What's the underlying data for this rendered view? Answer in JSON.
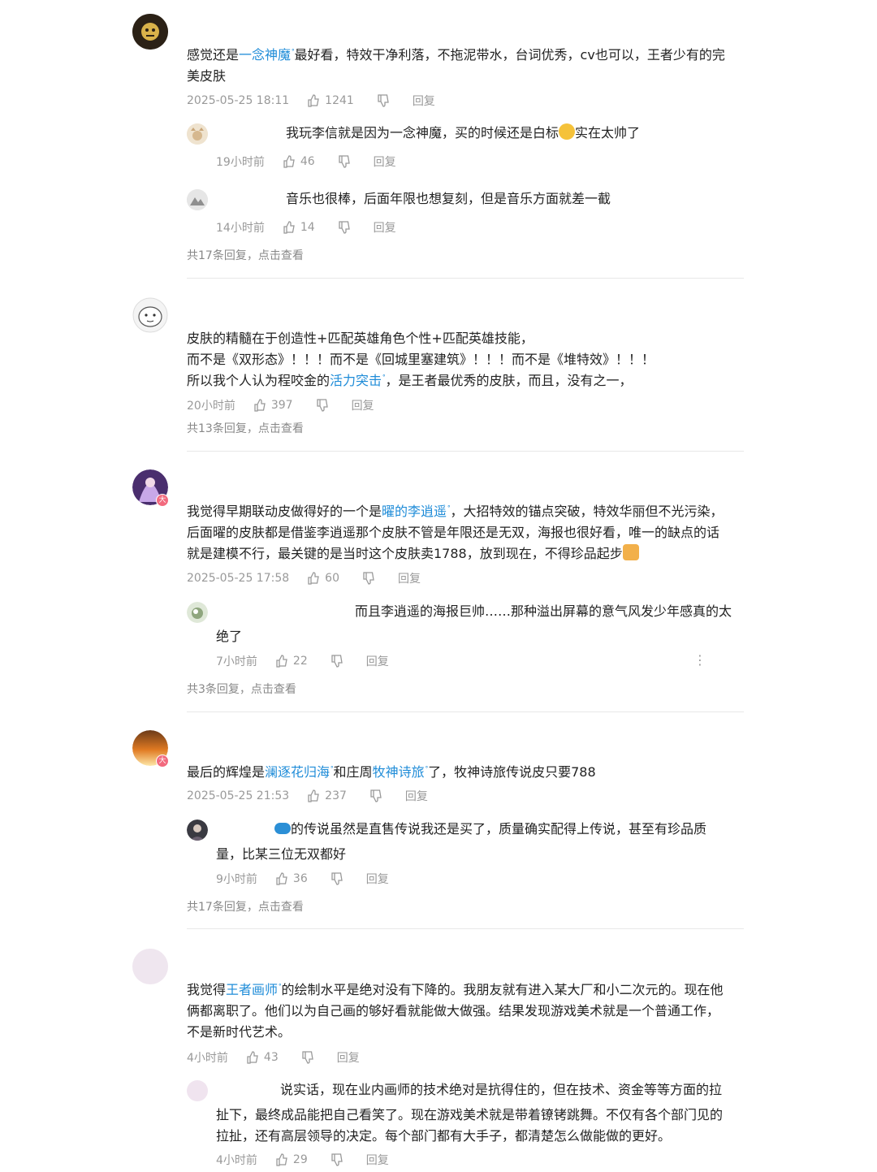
{
  "comments": [
    {
      "parts": [
        "感觉还是",
        "一念神魔",
        "最好看，特效干净利落，不拖泥带水，台词优秀，cv也可以，王者少有的完",
        "美皮肤"
      ],
      "time": "2025-05-25 18:11",
      "likes": "1241",
      "reply_label": "回复",
      "replies": [
        {
          "text_a": "我玩李信就是因为一念神魔，买的时候还是白标",
          "text_b": "实在太帅了",
          "time": "19小时前",
          "likes": "46",
          "reply_label": "回复"
        },
        {
          "text": "音乐也很棒，后面年限也想复刻，但是音乐方面就差一截",
          "time": "14小时前",
          "likes": "14",
          "reply_label": "回复"
        }
      ],
      "more": "共17条回复，点击查看"
    },
    {
      "line1": "皮肤的精髓在于创造性+匹配英雄角色个性+匹配英雄技能，",
      "line2": "而不是《双形态》！！！而不是《回城里塞建筑》！！！而不是《堆特效》！！！",
      "line3a": "所以我个人认为程咬金的",
      "line3hl": "活力突击",
      "line3b": "，是王者最优秀的皮肤，而且，没有之一，",
      "time": "20小时前",
      "likes": "397",
      "reply_label": "回复",
      "more": "共13条回复，点击查看"
    },
    {
      "l1a": "我觉得早期联动皮做得好的一个是",
      "l1hl": "曜的李逍遥",
      "l1b": "，大招特效的锚点突破，特效华丽但不光污染，",
      "l2": "后面曜的皮肤都是借鉴李逍遥那个皮肤不管是年限还是无双，海报也很好看，唯一的缺点的话",
      "l3": "就是建模不行，最关键的是当时这个皮肤卖1788，放到现在，不得珍品起步",
      "time": "2025-05-25 17:58",
      "likes": "60",
      "reply_label": "回复",
      "reply": {
        "l1": "而且李逍遥的海报巨帅……那种溢出屏幕的意气风发少年感真的太",
        "l2": "绝了",
        "time": "7小时前",
        "likes": "22",
        "reply_label": "回复",
        "more_icon": "⋮"
      },
      "more": "共3条回复，点击查看"
    },
    {
      "a": "最后的辉煌是",
      "hl1": "澜逐花归海",
      "b": "和庄周",
      "hl2": "牧神诗旅",
      "c": "了，牧神诗旅传说皮只要788",
      "time": "2025-05-25 21:53",
      "likes": "237",
      "reply_label": "回复",
      "reply": {
        "l1": "的传说虽然是直售传说我还是买了，质量确实配得上传说，甚至有珍品质",
        "l2": "量，比某三位无双都好",
        "time": "9小时前",
        "likes": "36",
        "reply_label": "回复"
      },
      "more": "共17条回复，点击查看"
    },
    {
      "a": "我觉得",
      "hl": "王者画师",
      "b": "的绘制水平是绝对没有下降的。我朋友就有进入某大厂和小二次元的。现在他",
      "l2": "俩都离职了。他们以为自己画的够好看就能做大做强。结果发现游戏美术就是一个普通工作，",
      "l3": "不是新时代艺术。",
      "time": "4小时前",
      "likes": "43",
      "reply_label": "回复",
      "reply": {
        "l1": "说实话，现在业内画师的技术绝对是抗得住的，但在技术、资金等等方面的拉",
        "l2": "扯下，最终成品能把自己看笑了。现在游戏美术就是带着镣铐跳舞。不仅有各个部门见的",
        "l3": "拉扯，还有高层领导的决定。每个部门都有大手子，都清楚怎么做能做的更好。",
        "time": "4小时前",
        "likes": "29",
        "reply_label": "回复"
      }
    }
  ],
  "badge_text": "大",
  "search_mark": "ᐤ"
}
